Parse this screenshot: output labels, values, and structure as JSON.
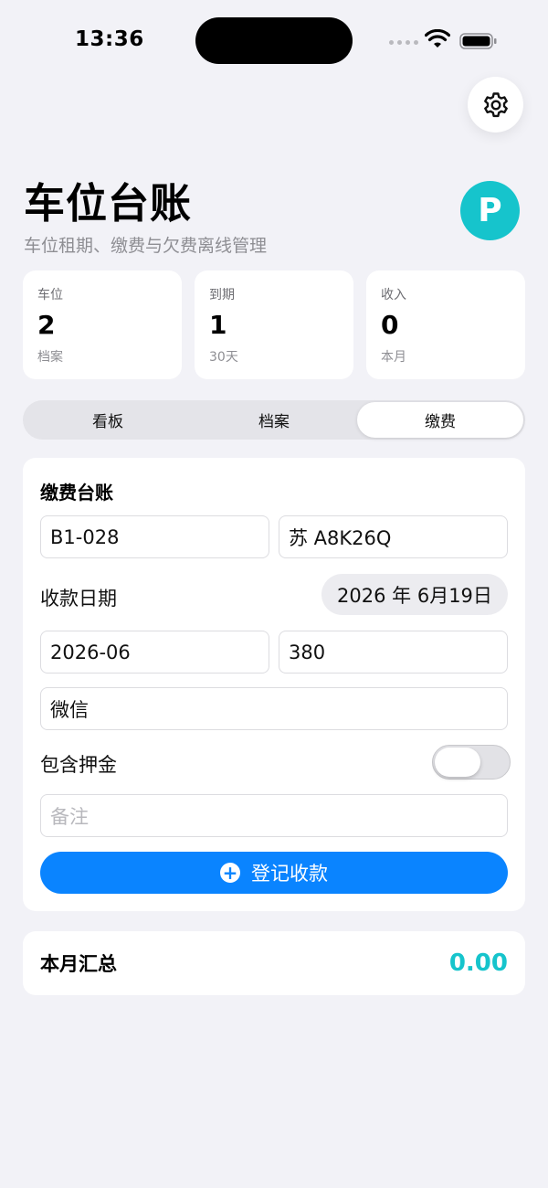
{
  "status_bar": {
    "time": "13:36"
  },
  "header": {
    "title": "车位台账",
    "subtitle": "车位租期、缴费与欠费离线管理",
    "avatar_letter": "P"
  },
  "stats": [
    {
      "label": "车位",
      "value": "2",
      "sub": "档案"
    },
    {
      "label": "到期",
      "value": "1",
      "sub": "30天"
    },
    {
      "label": "收入",
      "value": "0",
      "sub": "本月"
    }
  ],
  "tabs": [
    {
      "label": "看板",
      "active": false
    },
    {
      "label": "档案",
      "active": false
    },
    {
      "label": "缴费",
      "active": true
    }
  ],
  "payment_form": {
    "title": "缴费台账",
    "space_no": "B1-028",
    "plate": "苏 A8K26Q",
    "date_label": "收款日期",
    "date_value": "2026 年 6月19日",
    "period": "2026-06",
    "amount": "380",
    "method": "微信",
    "deposit_label": "包含押金",
    "deposit_on": false,
    "note_placeholder": "备注",
    "submit_label": "登记收款"
  },
  "summary": {
    "label": "本月汇总",
    "value": "0.00"
  },
  "colors": {
    "accent": "#0a84ff",
    "teal": "#16c4cc",
    "background": "#f2f2f7"
  },
  "icons": [
    "gear-icon",
    "wifi-icon",
    "battery-icon",
    "plus-circle-icon"
  ]
}
